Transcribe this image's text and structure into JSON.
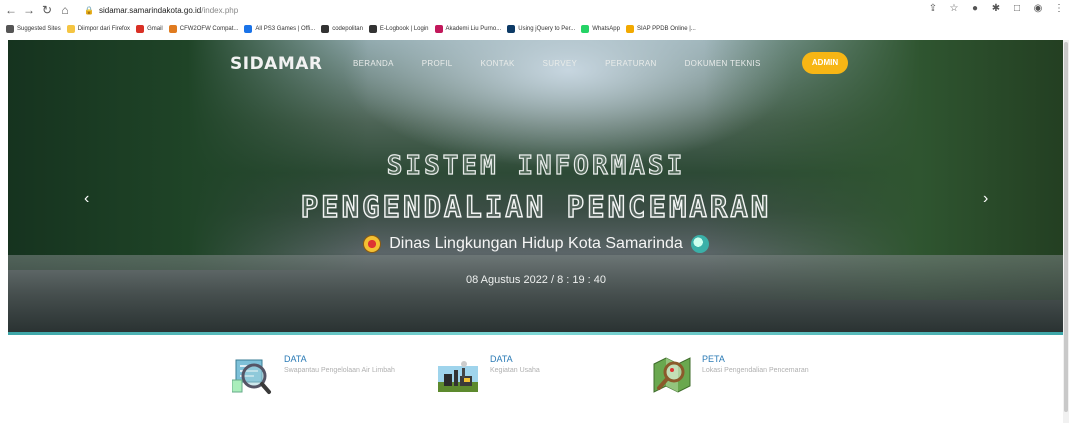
{
  "browser": {
    "url_host": "sidamar.samarindakota.go.id",
    "url_path": "/index.php",
    "bookmarks": [
      {
        "label": "Suggested Sites",
        "color": "#555555"
      },
      {
        "label": "Diimpor dari Firefox",
        "color": "#f5c542"
      },
      {
        "label": "Gmail",
        "color": "#d93025"
      },
      {
        "label": "CFW2OFW Compat...",
        "color": "#e07b1f"
      },
      {
        "label": "All PS3 Games | Offi...",
        "color": "#1a73e8"
      },
      {
        "label": "codepolitan",
        "color": "#333333"
      },
      {
        "label": "E-Logbook | Login",
        "color": "#333333"
      },
      {
        "label": "Akademi Liu Purno...",
        "color": "#c2185b"
      },
      {
        "label": "Using jQuery to Per...",
        "color": "#0d3a66"
      },
      {
        "label": "WhatsApp",
        "color": "#25d366"
      },
      {
        "label": "SIAP PPDB Online |...",
        "color": "#f2a900"
      }
    ]
  },
  "site": {
    "logo": "SIDAMAR",
    "menu": [
      "BERANDA",
      "PROFIL",
      "KONTAK",
      "SURVEY",
      "PERATURAN",
      "DOKUMEN TEKNIS"
    ],
    "admin": "ADMIN"
  },
  "hero": {
    "title_line1": "SISTEM INFORMASI",
    "title_line2": "PENGENDALIAN PENCEMARAN",
    "subtitle": "Dinas Lingkungan Hidup Kota Samarinda",
    "datetime": "08 Agustus 2022 / 8 : 19 : 40"
  },
  "cards": [
    {
      "head": "DATA",
      "sub": "Swapantau Pengelolaan Air Limbah"
    },
    {
      "head": "DATA",
      "sub": "Kegiatan Usaha"
    },
    {
      "head": "PETA",
      "sub": "Lokasi Pengendalian Pencemaran"
    }
  ],
  "colors": {
    "admin": "#f7b615",
    "link": "#2a7ab5",
    "divider": "#3da6a8"
  }
}
